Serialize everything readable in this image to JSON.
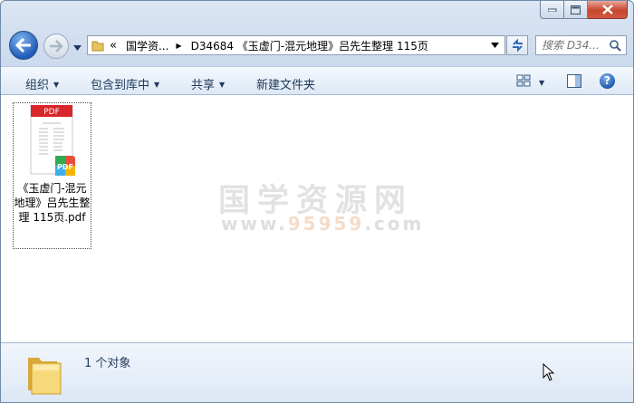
{
  "window": {
    "caption_buttons": [
      "minimize-icon",
      "maximize-icon",
      "close-icon"
    ]
  },
  "address": {
    "overflow_chevron": "«",
    "crumbs": [
      "国学资...",
      "D34684 《玉虚门-混元地理》吕先生整理 115页"
    ]
  },
  "search": {
    "placeholder": "搜索 D34..."
  },
  "toolbar": {
    "organize": "组织",
    "include_in_library": "包含到库中",
    "share": "共享",
    "new_folder": "新建文件夹"
  },
  "files": [
    {
      "name": "《玉虚门-混元地理》吕先生整理 115页.pdf",
      "thumb_label": "PDF",
      "icon": "pdf-file-icon"
    }
  ],
  "watermark": {
    "text": "国学资源网",
    "url_prefix": "www.",
    "url_number": "95959",
    "url_suffix": ".com"
  },
  "status": {
    "count_text": "1 个对象"
  },
  "colors": {
    "pdf_red": "#d8262b",
    "window_frame": "#dbe6f4",
    "accent_text": "#1e395b"
  }
}
